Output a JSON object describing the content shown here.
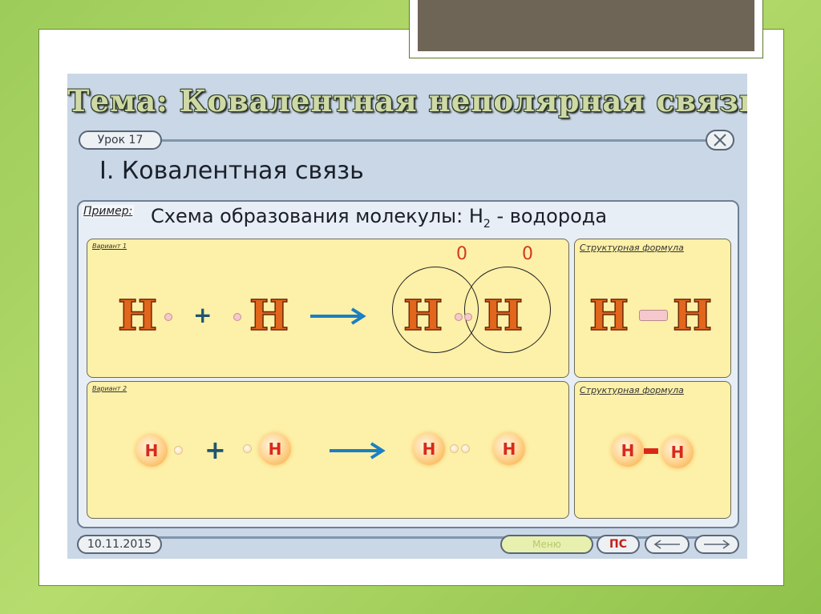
{
  "slide": {
    "title": "Тема: Ковалентная неполярная связь.",
    "lesson": "Урок 17",
    "close_icon": "close-icon",
    "section_heading": "I. Ковалентная связь",
    "example_label": "Пример:",
    "scheme_prefix": "Схема образования молекулы: H",
    "scheme_sub": "2",
    "scheme_suffix": " - водорода",
    "variant1": {
      "label": "Вариант 1",
      "atom1": "H",
      "plus": "+",
      "atom2": "H",
      "arrow_icon": "right-arrow-icon",
      "product1": "H",
      "product2": "H",
      "charge1": "0",
      "charge2": "0"
    },
    "variant1_formula": {
      "label": "Структурная формула",
      "atom1": "H",
      "atom2": "H"
    },
    "variant2": {
      "label": "Вариант 2",
      "atom1": "H",
      "plus": "+",
      "atom2": "H",
      "arrow_icon": "right-arrow-icon",
      "product1": "H",
      "product2": "H"
    },
    "variant2_formula": {
      "label": "Структурная формула",
      "atom1": "H",
      "atom2": "H"
    },
    "footer": {
      "date": "10.11.2015",
      "menu_button": "Меню",
      "ps_button": "ПС",
      "back_icon": "left-arrow-icon",
      "forward_icon": "right-arrow-icon"
    }
  },
  "colors": {
    "background_green": "#9dcc5a",
    "screen_blue": "#c9d7e6",
    "panel_yellow": "#fdf0a8",
    "atom_orange": "#e2661c",
    "arrow_blue": "#1a7fc4",
    "charge_red": "#d23a20"
  }
}
